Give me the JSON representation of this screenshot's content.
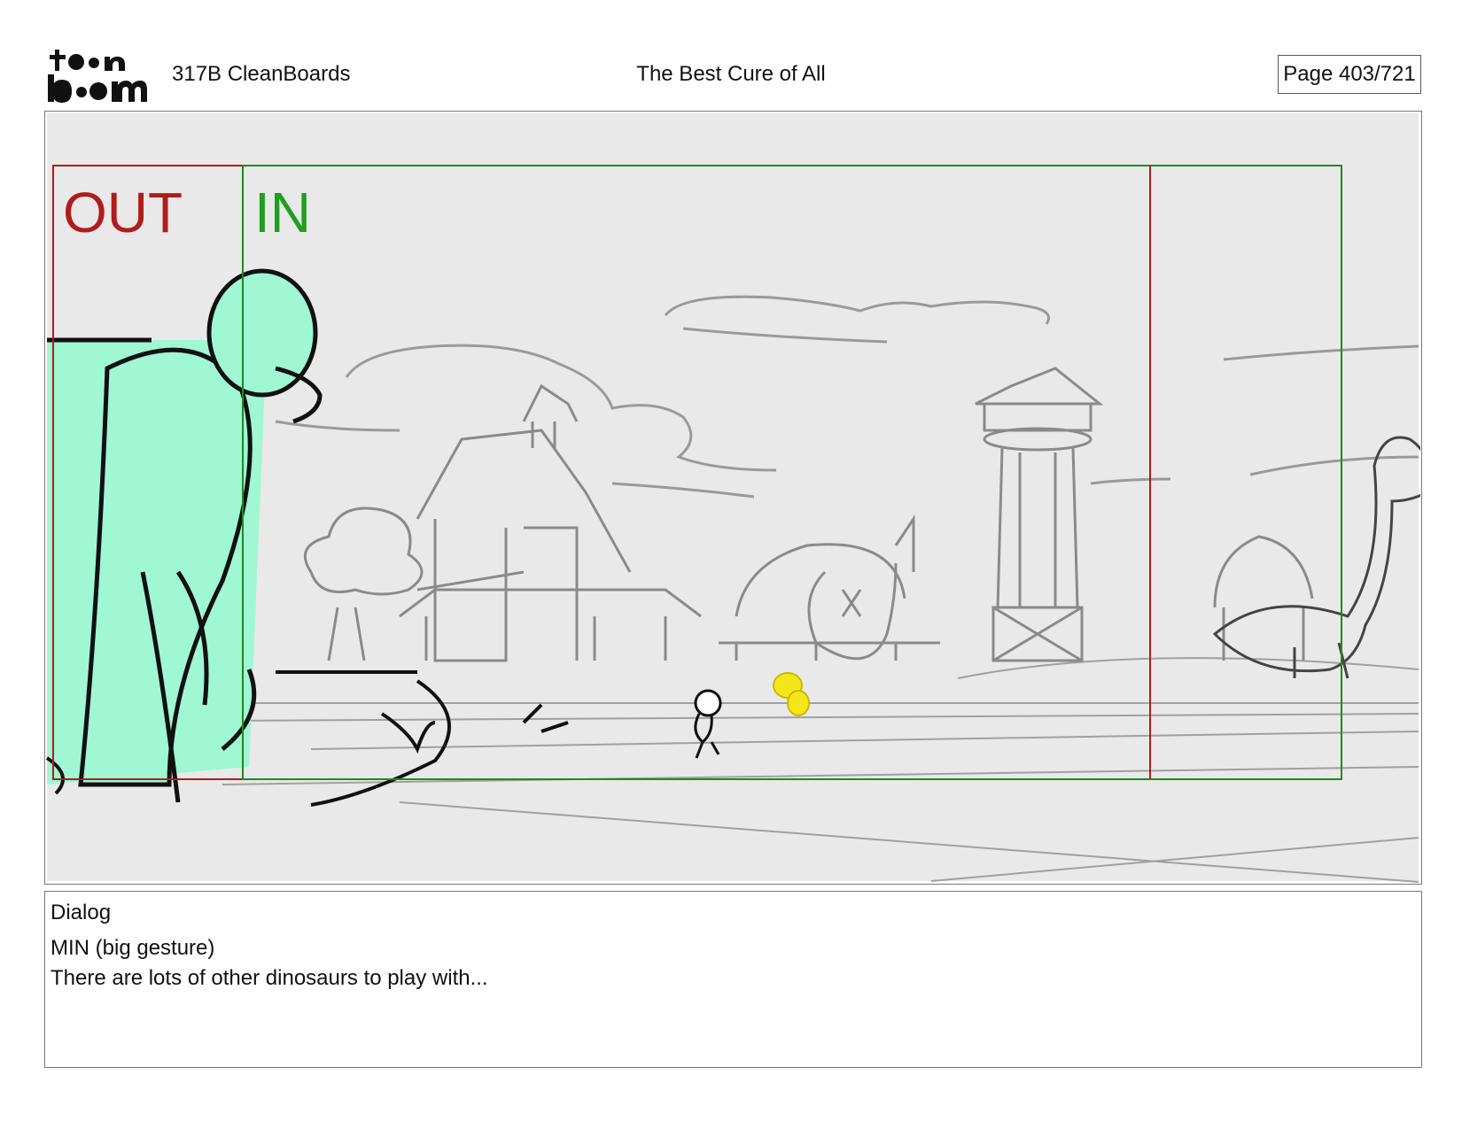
{
  "header": {
    "logo_text_top": "toon",
    "logo_text_bottom": "boom",
    "project": "317B  CleanBoards",
    "title": "The Best Cure of All",
    "page": "Page 403/721"
  },
  "panel": {
    "out_label": "OUT",
    "in_label": "IN"
  },
  "dialog": {
    "heading": "Dialog",
    "speaker": "MIN (big gesture)",
    "line": "There are lots of other dinosaurs to play with..."
  },
  "colors": {
    "out_frame": "#b01c1c",
    "in_frame": "#1f8a1f",
    "background_sketch": "#eeeeee",
    "character_fill": "#9ff7d4",
    "highlight_character": "#f5e61a"
  }
}
